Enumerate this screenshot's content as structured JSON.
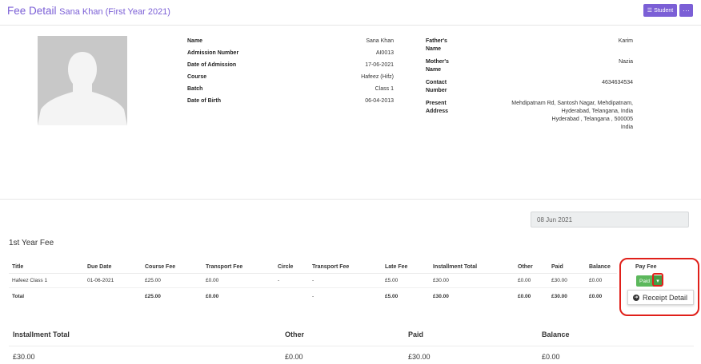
{
  "header": {
    "title": "Fee Detail",
    "subtitle": "Sana Khan (First Year 2021)",
    "student_button": "Student",
    "more_button": "···"
  },
  "profile": {
    "fields": [
      {
        "label": "Name",
        "value": "Sana Khan"
      },
      {
        "label": "Admission Number",
        "value": "AI0013"
      },
      {
        "label": "Date of Admission",
        "value": "17-06-2021"
      },
      {
        "label": "Course",
        "value": "Hafeez (Hifz)"
      },
      {
        "label": "Batch",
        "value": "Class 1"
      },
      {
        "label": "Date of Birth",
        "value": "06-04-2013"
      }
    ],
    "fields_right": [
      {
        "label": "Father's Name",
        "value": "Karim"
      },
      {
        "label": "Mother's Name",
        "value": "Nazia"
      },
      {
        "label": "Contact Number",
        "value": "4634634534"
      }
    ],
    "address": {
      "label": "Present Address",
      "lines": [
        "Mehdipatnam Rd, Santosh Nagar, Mehdipatnam,",
        "Hyderabad, Telangana, India",
        "Hyderabad , Telangana , 500005",
        "India"
      ]
    }
  },
  "date_filter": {
    "value": "08 Jun 2021"
  },
  "fee_section": {
    "title": "1st Year Fee",
    "headers": [
      "Title",
      "Due Date",
      "Course Fee",
      "Transport Fee",
      "Circle",
      "Transport Fee",
      "Late Fee",
      "Installment Total",
      "Other",
      "Paid",
      "Balance",
      "Pay Fee"
    ],
    "row": [
      "Hafeez Class 1",
      "01-06-2021",
      "£25.00",
      "£0.00",
      "-",
      "-",
      "£5.00",
      "£30.00",
      "£0.00",
      "£30.00",
      "£0.00"
    ],
    "total": [
      "Total",
      "",
      "£25.00",
      "£0.00",
      "",
      "-",
      "£5.00",
      "£30.00",
      "£0.00",
      "£30.00",
      "£0.00"
    ],
    "paid_button": "Paid",
    "dropdown_item": "Receipt Detail"
  },
  "summary": {
    "headers": [
      "Installment Total",
      "Other",
      "Paid",
      "Balance"
    ],
    "values": [
      "£30.00",
      "£0.00",
      "£30.00",
      "£0.00"
    ]
  },
  "colors": {
    "accent": "#7b5fd6",
    "success": "#5cb85c",
    "highlight": "#e0201a"
  }
}
